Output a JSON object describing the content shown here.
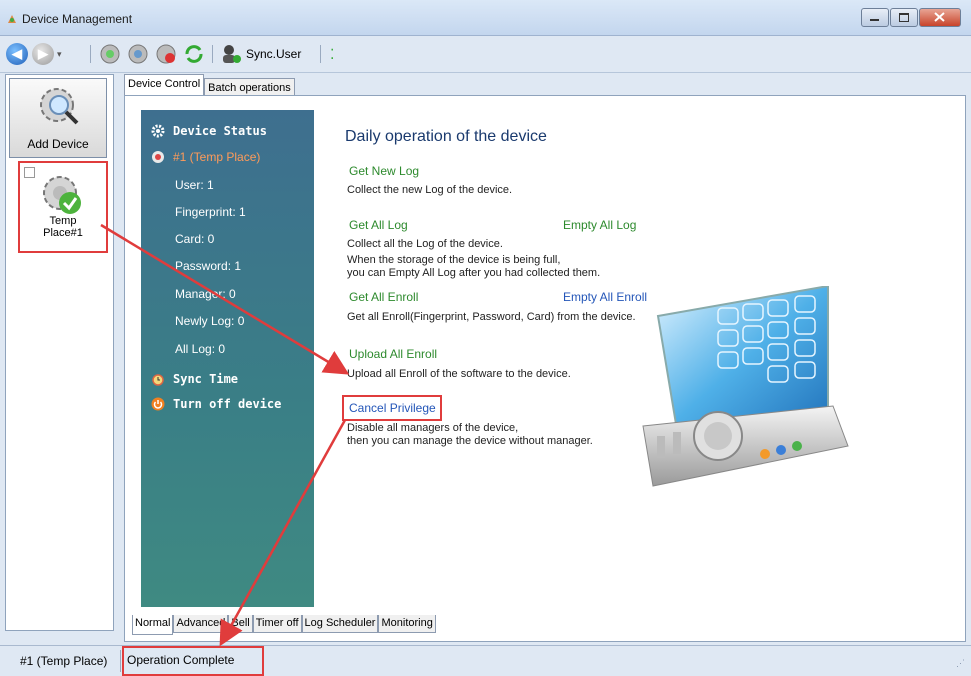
{
  "window": {
    "title": "Device Management"
  },
  "toolbar": {
    "sync_user": "Sync.User"
  },
  "sidebar": {
    "add_device": "Add Device",
    "device_label_line1": "Temp",
    "device_label_line2": "Place#1"
  },
  "tabs_top": [
    "Device Control",
    "Batch operations"
  ],
  "status": {
    "heading": "Device Status",
    "device": "#1 (Temp Place)",
    "user": "User: 1",
    "fingerprint": "Fingerprint: 1",
    "card": "Card: 0",
    "password": "Password: 1",
    "manager": "Manager: 0",
    "newly_log": "Newly Log: 0",
    "all_log": "All Log: 0",
    "sync_time": "Sync Time",
    "turn_off": "Turn off device"
  },
  "content": {
    "heading": "Daily operation of the device",
    "get_new_log": "Get New Log",
    "get_new_log_desc": "Collect the new Log of the device.",
    "get_all_log": "Get All Log",
    "empty_all_log": "Empty All Log",
    "get_all_log_desc1": "Collect all the Log of the device.",
    "get_all_log_desc2": "When the storage of the device is being full,",
    "get_all_log_desc3": "you can Empty All Log after you had collected them.",
    "get_all_enroll": "Get All Enroll",
    "empty_all_enroll": "Empty All Enroll",
    "get_all_enroll_desc": "Get all Enroll(Fingerprint, Password, Card) from the device.",
    "upload_all_enroll": "Upload All Enroll",
    "upload_all_enroll_desc": "Upload all Enroll of the software to the device.",
    "cancel_privilege": "Cancel Privilege",
    "cancel_desc1": "Disable all managers of the device,",
    "cancel_desc2": "then you can manage the device without manager."
  },
  "tabs_bottom": [
    "Normal",
    "Advanced",
    "Bell",
    "Timer off",
    "Log Scheduler",
    "Monitoring"
  ],
  "statusbar": {
    "device": "#1 (Temp Place)",
    "message": "Operation Complete"
  },
  "colors": {
    "accent_red": "#e03c3c",
    "panel_blue": "#3e6f8f",
    "link_green": "#2d8a2d",
    "link_blue": "#2456b8"
  }
}
